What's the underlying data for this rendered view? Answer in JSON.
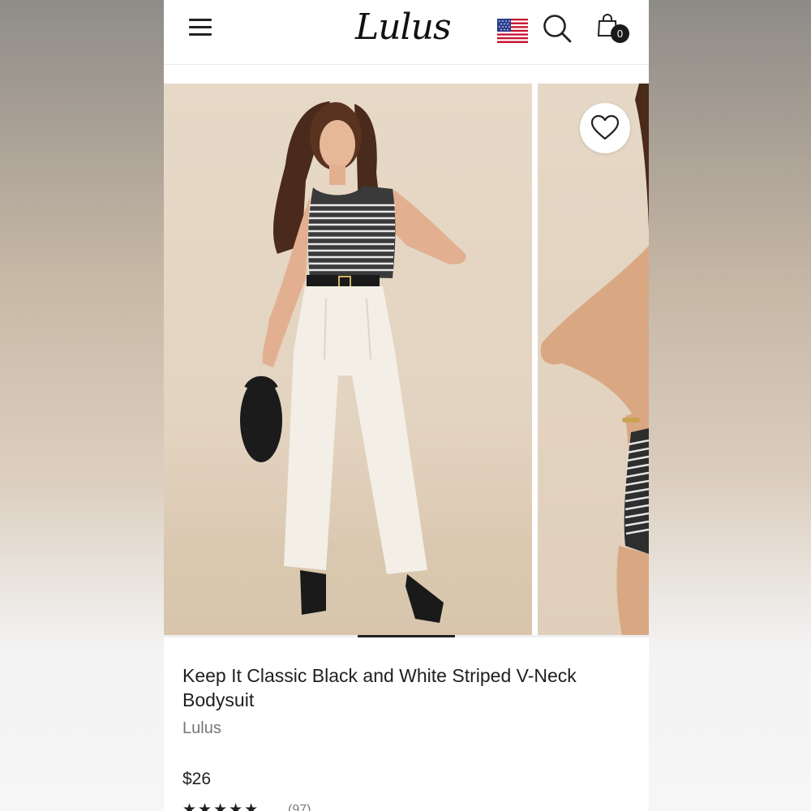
{
  "header": {
    "logo_text": "Lulus",
    "cart_count": "0",
    "icons": [
      "hamburger-menu-icon",
      "us-flag-icon",
      "search-icon",
      "shopping-bag-icon"
    ]
  },
  "gallery": {
    "wishlist_icon": "heart-icon",
    "active_slide": 1,
    "slide_count": 5
  },
  "product": {
    "title": "Keep It Classic Black and White Striped V-Neck Bodysuit",
    "brand": "Lulus",
    "price": "$26",
    "rating_stars": "★★★★★",
    "rating_count": "(97)"
  },
  "colors": {
    "text": "#1f1f1f",
    "muted": "#777777",
    "backdrop": "#e3d4c1"
  }
}
